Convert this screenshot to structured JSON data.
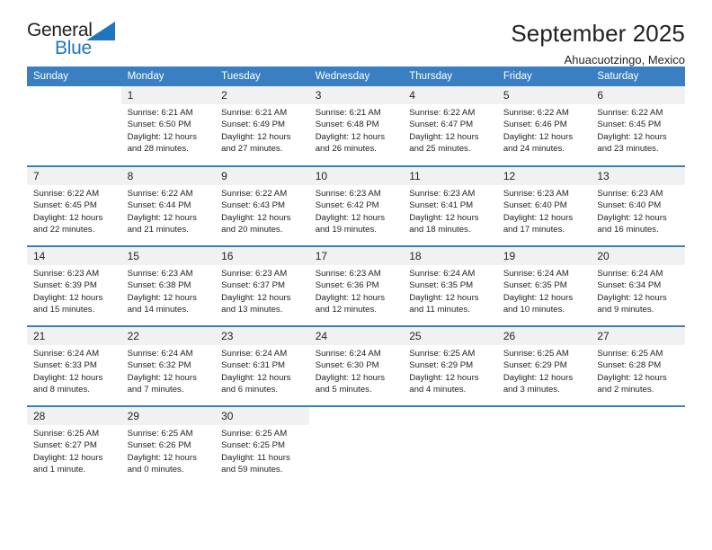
{
  "brand": {
    "word1": "General",
    "word2": "Blue",
    "accent_color": "#1f76bc"
  },
  "header": {
    "title": "September 2025",
    "subtitle": "Ahuacuotzingo, Mexico"
  },
  "calendar": {
    "header_color": "#3a7fc1",
    "weekdays": [
      "Sunday",
      "Monday",
      "Tuesday",
      "Wednesday",
      "Thursday",
      "Friday",
      "Saturday"
    ],
    "weeks": [
      [
        {
          "day": "",
          "sunrise": "",
          "sunset": "",
          "daylight": ""
        },
        {
          "day": "1",
          "sunrise": "Sunrise: 6:21 AM",
          "sunset": "Sunset: 6:50 PM",
          "daylight": "Daylight: 12 hours and 28 minutes."
        },
        {
          "day": "2",
          "sunrise": "Sunrise: 6:21 AM",
          "sunset": "Sunset: 6:49 PM",
          "daylight": "Daylight: 12 hours and 27 minutes."
        },
        {
          "day": "3",
          "sunrise": "Sunrise: 6:21 AM",
          "sunset": "Sunset: 6:48 PM",
          "daylight": "Daylight: 12 hours and 26 minutes."
        },
        {
          "day": "4",
          "sunrise": "Sunrise: 6:22 AM",
          "sunset": "Sunset: 6:47 PM",
          "daylight": "Daylight: 12 hours and 25 minutes."
        },
        {
          "day": "5",
          "sunrise": "Sunrise: 6:22 AM",
          "sunset": "Sunset: 6:46 PM",
          "daylight": "Daylight: 12 hours and 24 minutes."
        },
        {
          "day": "6",
          "sunrise": "Sunrise: 6:22 AM",
          "sunset": "Sunset: 6:45 PM",
          "daylight": "Daylight: 12 hours and 23 minutes."
        }
      ],
      [
        {
          "day": "7",
          "sunrise": "Sunrise: 6:22 AM",
          "sunset": "Sunset: 6:45 PM",
          "daylight": "Daylight: 12 hours and 22 minutes."
        },
        {
          "day": "8",
          "sunrise": "Sunrise: 6:22 AM",
          "sunset": "Sunset: 6:44 PM",
          "daylight": "Daylight: 12 hours and 21 minutes."
        },
        {
          "day": "9",
          "sunrise": "Sunrise: 6:22 AM",
          "sunset": "Sunset: 6:43 PM",
          "daylight": "Daylight: 12 hours and 20 minutes."
        },
        {
          "day": "10",
          "sunrise": "Sunrise: 6:23 AM",
          "sunset": "Sunset: 6:42 PM",
          "daylight": "Daylight: 12 hours and 19 minutes."
        },
        {
          "day": "11",
          "sunrise": "Sunrise: 6:23 AM",
          "sunset": "Sunset: 6:41 PM",
          "daylight": "Daylight: 12 hours and 18 minutes."
        },
        {
          "day": "12",
          "sunrise": "Sunrise: 6:23 AM",
          "sunset": "Sunset: 6:40 PM",
          "daylight": "Daylight: 12 hours and 17 minutes."
        },
        {
          "day": "13",
          "sunrise": "Sunrise: 6:23 AM",
          "sunset": "Sunset: 6:40 PM",
          "daylight": "Daylight: 12 hours and 16 minutes."
        }
      ],
      [
        {
          "day": "14",
          "sunrise": "Sunrise: 6:23 AM",
          "sunset": "Sunset: 6:39 PM",
          "daylight": "Daylight: 12 hours and 15 minutes."
        },
        {
          "day": "15",
          "sunrise": "Sunrise: 6:23 AM",
          "sunset": "Sunset: 6:38 PM",
          "daylight": "Daylight: 12 hours and 14 minutes."
        },
        {
          "day": "16",
          "sunrise": "Sunrise: 6:23 AM",
          "sunset": "Sunset: 6:37 PM",
          "daylight": "Daylight: 12 hours and 13 minutes."
        },
        {
          "day": "17",
          "sunrise": "Sunrise: 6:23 AM",
          "sunset": "Sunset: 6:36 PM",
          "daylight": "Daylight: 12 hours and 12 minutes."
        },
        {
          "day": "18",
          "sunrise": "Sunrise: 6:24 AM",
          "sunset": "Sunset: 6:35 PM",
          "daylight": "Daylight: 12 hours and 11 minutes."
        },
        {
          "day": "19",
          "sunrise": "Sunrise: 6:24 AM",
          "sunset": "Sunset: 6:35 PM",
          "daylight": "Daylight: 12 hours and 10 minutes."
        },
        {
          "day": "20",
          "sunrise": "Sunrise: 6:24 AM",
          "sunset": "Sunset: 6:34 PM",
          "daylight": "Daylight: 12 hours and 9 minutes."
        }
      ],
      [
        {
          "day": "21",
          "sunrise": "Sunrise: 6:24 AM",
          "sunset": "Sunset: 6:33 PM",
          "daylight": "Daylight: 12 hours and 8 minutes."
        },
        {
          "day": "22",
          "sunrise": "Sunrise: 6:24 AM",
          "sunset": "Sunset: 6:32 PM",
          "daylight": "Daylight: 12 hours and 7 minutes."
        },
        {
          "day": "23",
          "sunrise": "Sunrise: 6:24 AM",
          "sunset": "Sunset: 6:31 PM",
          "daylight": "Daylight: 12 hours and 6 minutes."
        },
        {
          "day": "24",
          "sunrise": "Sunrise: 6:24 AM",
          "sunset": "Sunset: 6:30 PM",
          "daylight": "Daylight: 12 hours and 5 minutes."
        },
        {
          "day": "25",
          "sunrise": "Sunrise: 6:25 AM",
          "sunset": "Sunset: 6:29 PM",
          "daylight": "Daylight: 12 hours and 4 minutes."
        },
        {
          "day": "26",
          "sunrise": "Sunrise: 6:25 AM",
          "sunset": "Sunset: 6:29 PM",
          "daylight": "Daylight: 12 hours and 3 minutes."
        },
        {
          "day": "27",
          "sunrise": "Sunrise: 6:25 AM",
          "sunset": "Sunset: 6:28 PM",
          "daylight": "Daylight: 12 hours and 2 minutes."
        }
      ],
      [
        {
          "day": "28",
          "sunrise": "Sunrise: 6:25 AM",
          "sunset": "Sunset: 6:27 PM",
          "daylight": "Daylight: 12 hours and 1 minute."
        },
        {
          "day": "29",
          "sunrise": "Sunrise: 6:25 AM",
          "sunset": "Sunset: 6:26 PM",
          "daylight": "Daylight: 12 hours and 0 minutes."
        },
        {
          "day": "30",
          "sunrise": "Sunrise: 6:25 AM",
          "sunset": "Sunset: 6:25 PM",
          "daylight": "Daylight: 11 hours and 59 minutes."
        },
        {
          "day": "",
          "sunrise": "",
          "sunset": "",
          "daylight": ""
        },
        {
          "day": "",
          "sunrise": "",
          "sunset": "",
          "daylight": ""
        },
        {
          "day": "",
          "sunrise": "",
          "sunset": "",
          "daylight": ""
        },
        {
          "day": "",
          "sunrise": "",
          "sunset": "",
          "daylight": ""
        }
      ]
    ]
  }
}
